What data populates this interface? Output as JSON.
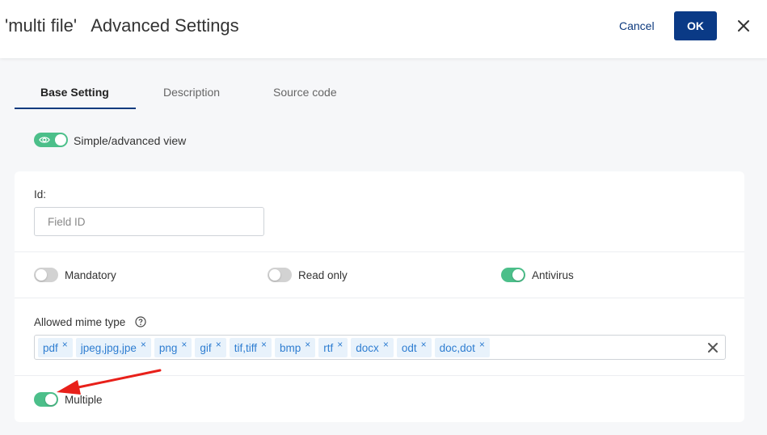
{
  "header": {
    "title": "'multi file'   Advanced Settings",
    "cancel_label": "Cancel",
    "ok_label": "OK",
    "close_icon": "close-icon"
  },
  "tabs": [
    {
      "label": "Base Setting",
      "active": true
    },
    {
      "label": "Description",
      "active": false
    },
    {
      "label": "Source code",
      "active": false
    }
  ],
  "view_toggle": {
    "label": "Simple/advanced view",
    "on": true,
    "icon": "eye-icon"
  },
  "id_field": {
    "label": "Id:",
    "placeholder": "Field ID",
    "value": ""
  },
  "switches": [
    {
      "label": "Mandatory",
      "on": false
    },
    {
      "label": "Read only",
      "on": false
    },
    {
      "label": "Antivirus",
      "on": true
    }
  ],
  "mime": {
    "label": "Allowed mime type",
    "help_icon": "question-circle-icon",
    "tags": [
      "pdf",
      "jpeg,jpg,jpe",
      "png",
      "gif",
      "tif,tiff",
      "bmp",
      "rtf",
      "docx",
      "odt",
      "doc,dot"
    ],
    "remove_symbol": "×"
  },
  "multiple": {
    "label": "Multiple",
    "on": true
  },
  "colors": {
    "accent": "#0a3a86",
    "toggle_on": "#4cbf8a",
    "toggle_off": "#d2d2d2",
    "annotation_arrow": "#e8201a"
  }
}
